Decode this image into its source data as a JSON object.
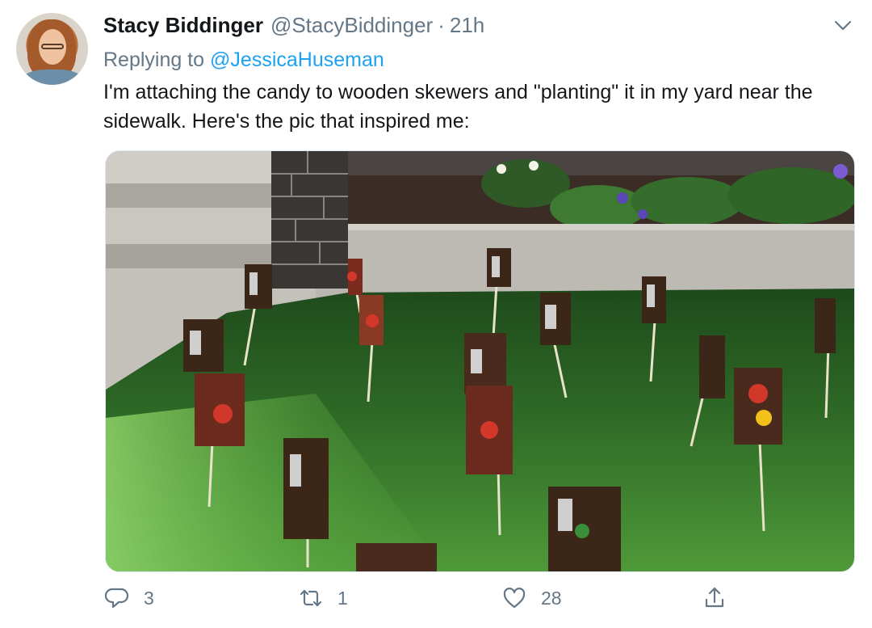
{
  "tweet": {
    "author": {
      "name": "Stacy Biddinger",
      "handle": "@StacyBiddinger",
      "separator": "·",
      "time": "21h"
    },
    "reply_to": {
      "prefix": "Replying to",
      "mention": "@JessicaHuseman"
    },
    "text": "I'm attaching the candy to wooden skewers and \"planting\" it in my yard near the sidewalk. Here's the pic that inspired me:",
    "stats": {
      "replies": "3",
      "retweets": "1",
      "likes": "28"
    },
    "icons": {
      "menu": "chevron-down-icon",
      "reply": "reply-icon",
      "retweet": "retweet-icon",
      "like": "heart-icon",
      "share": "share-icon"
    },
    "colors": {
      "link": "#1da1f2",
      "secondary_text": "#657786",
      "primary_text": "#14171a"
    }
  }
}
